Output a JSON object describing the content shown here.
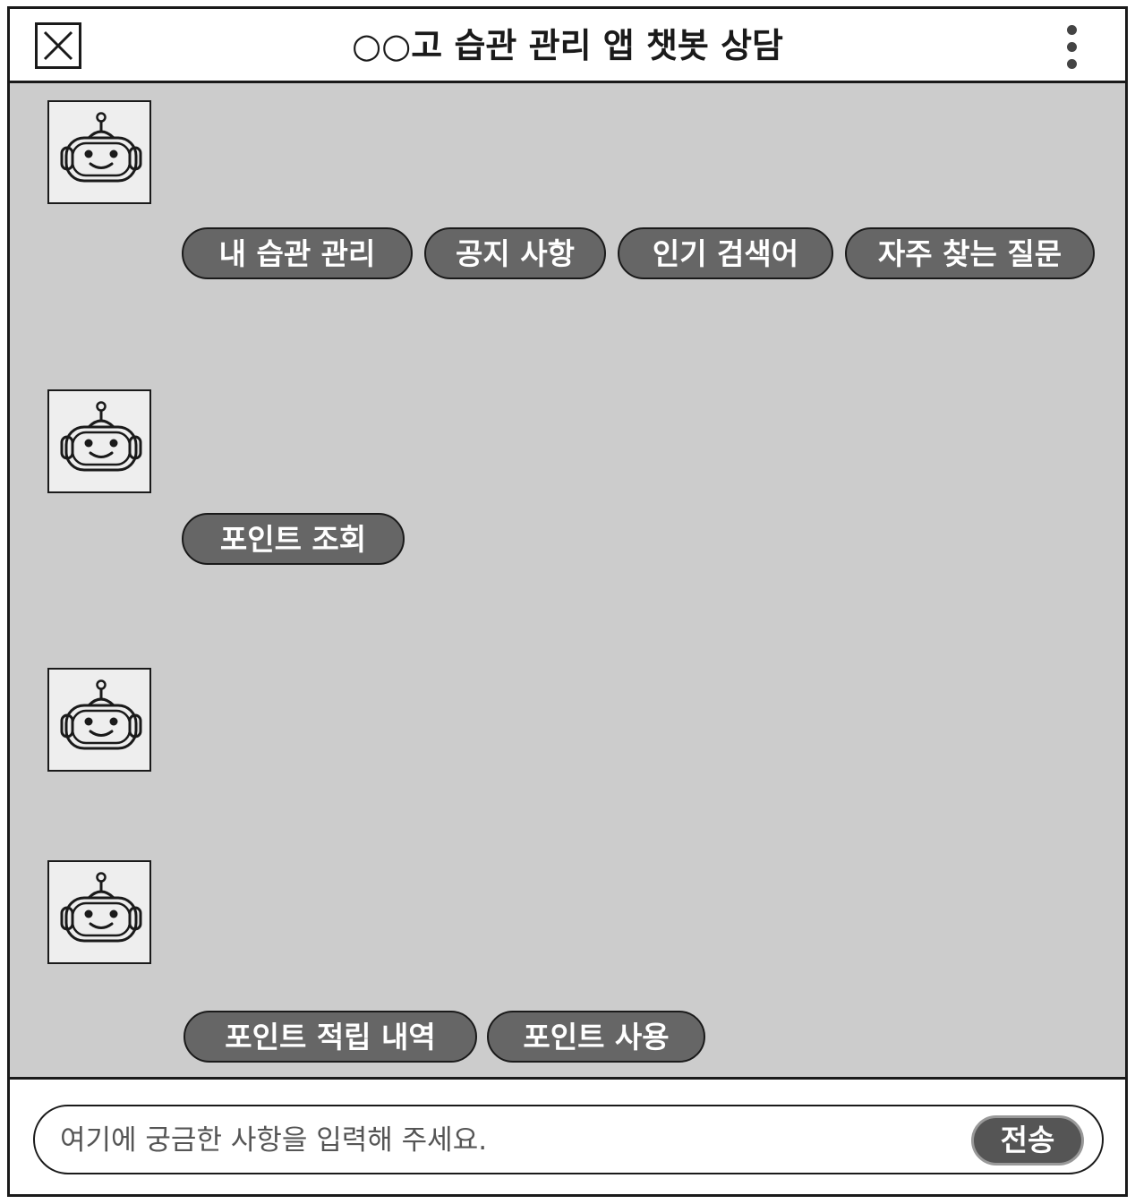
{
  "header": {
    "title": "○○고 습관 관리 앱 챗봇 상담",
    "close_icon": "close-icon",
    "menu_icon": "more-vertical-icon"
  },
  "chat": {
    "messages": [
      {
        "avatar_icon": "robot-icon",
        "quick_replies": [
          "내 습관 관리",
          "공지 사항",
          "인기 검색어",
          "자주 찾는 질문"
        ]
      },
      {
        "avatar_icon": "robot-icon",
        "quick_replies": [
          "포인트 조회"
        ]
      },
      {
        "avatar_icon": "robot-icon",
        "quick_replies": []
      },
      {
        "avatar_icon": "robot-icon",
        "quick_replies": [
          "포인트 적립 내역",
          "포인트 사용"
        ]
      }
    ]
  },
  "composer": {
    "placeholder": "여기에 궁금한 사항을 입력해 주세요.",
    "value": "",
    "send_label": "전송"
  },
  "colors": {
    "chat_background": "#cccccc",
    "chip_background": "#666666",
    "send_background": "#555555"
  }
}
